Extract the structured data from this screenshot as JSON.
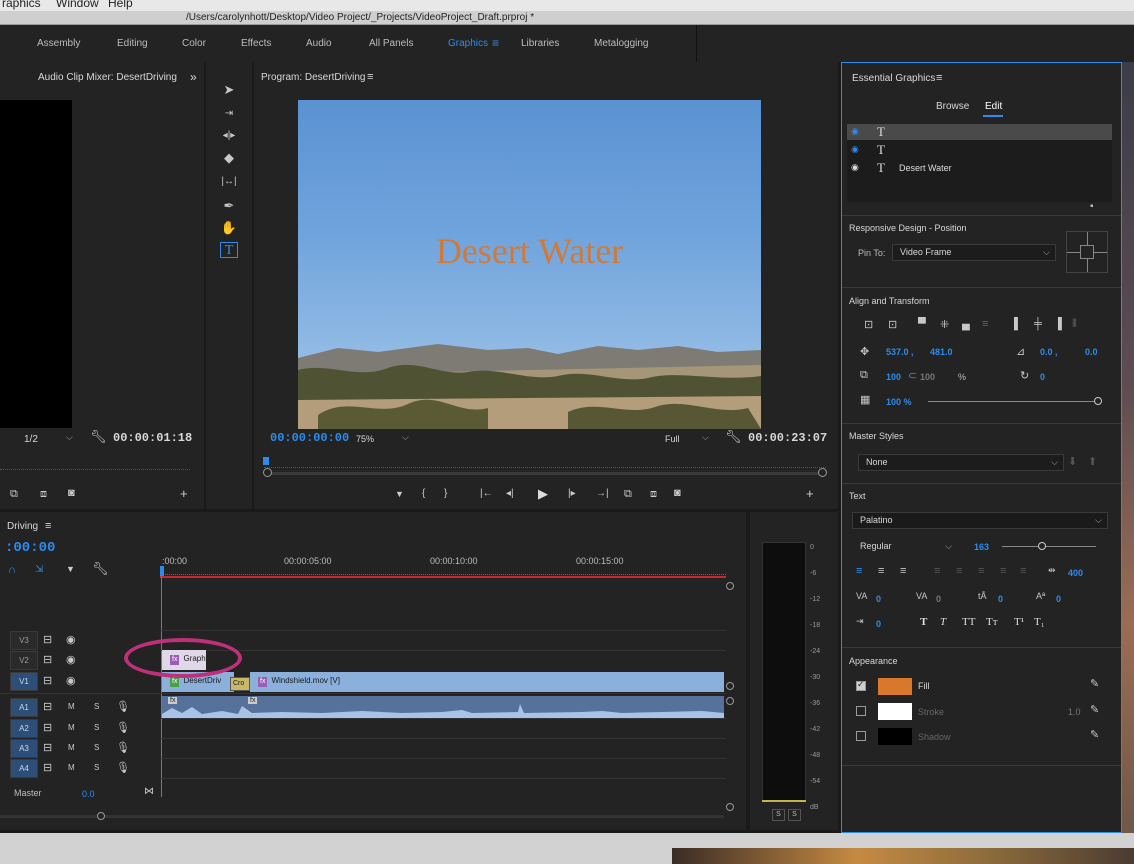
{
  "menubar": {
    "items": [
      "raphics",
      "Window",
      "Help"
    ]
  },
  "window": {
    "title": "/Users/carolynhott/Desktop/Video Project/_Projects/VideoProject_Draft.prproj *"
  },
  "workspaces": {
    "tabs": [
      "Assembly",
      "Editing",
      "Color",
      "Effects",
      "Audio",
      "All Panels",
      "Graphics",
      "Libraries",
      "Metalogging"
    ],
    "active": "Graphics",
    "menu_glyph": "≡"
  },
  "mixer": {
    "title": "Audio Clip Mixer: DesertDriving",
    "more": "»",
    "fraction": "1/2",
    "timecode": "00:00:01:18"
  },
  "program": {
    "title": "Program: DesertDriving",
    "menu_glyph": "≡",
    "video_title": "Desert Water",
    "timecode_current": "00:00:00:00",
    "zoom": "75%",
    "resolution": "Full",
    "timecode_duration": "00:00:23:07"
  },
  "timeline": {
    "title": "Driving",
    "menu_glyph": "≡",
    "timecode": ":00:00",
    "ruler": [
      ":00:00",
      "00:00:05:00",
      "00:00:10:00",
      "00:00:15:00"
    ],
    "tracks": [
      {
        "label": "V3",
        "on": false
      },
      {
        "label": "V2",
        "on": false
      },
      {
        "label": "V1",
        "on": true
      },
      {
        "label": "A1",
        "on": true
      },
      {
        "label": "A2",
        "on": true
      },
      {
        "label": "A3",
        "on": true
      },
      {
        "label": "A4",
        "on": true
      }
    ],
    "track_m": "M",
    "track_s": "S",
    "master_label": "Master",
    "master_value": "0.0",
    "clips": {
      "graphic": "Graph",
      "desert": "DesertDriv",
      "windshield": "Windshield.mov [V]",
      "cross": "Cro"
    }
  },
  "meter": {
    "scale": [
      "0",
      "-6",
      "-12",
      "-18",
      "-24",
      "-30",
      "-36",
      "-42",
      "-48",
      "-54",
      "dB"
    ],
    "solo": [
      "S",
      "S"
    ]
  },
  "essential_graphics": {
    "title": "Essential Graphics",
    "menu_glyph": "≡",
    "tabs": [
      "Browse",
      "Edit"
    ],
    "active_tab": "Edit",
    "layers": [
      {
        "glyph": "T",
        "name": ""
      },
      {
        "glyph": "T",
        "name": ""
      },
      {
        "glyph": "T",
        "name": "Desert Water"
      }
    ],
    "responsive_title": "Responsive Design - Position",
    "pin_label": "Pin To:",
    "pin_value": "Video Frame",
    "align_title": "Align and Transform",
    "pos_x": "537.0 ,",
    "pos_y": "481.0",
    "anchor_x": "0.0 ,",
    "anchor_y": "0.0",
    "scale": "100",
    "scale_h": "100",
    "scale_unit": "%",
    "rotation": "0",
    "opacity": "100 %",
    "master_styles_title": "Master Styles",
    "master_style": "None",
    "text_title": "Text",
    "font": "Palatino",
    "font_style": "Regular",
    "font_size": "163",
    "tracking": "400",
    "kerning": "0",
    "leading": "0",
    "baseline": "0",
    "tsume": "0",
    "tab_width": "0",
    "caps_buttons": [
      "T",
      "T",
      "TT",
      "Tт",
      "T¹",
      "T₁"
    ],
    "appearance_title": "Appearance",
    "fill_label": "Fill",
    "stroke_label": "Stroke",
    "stroke_value": "1.0",
    "shadow_label": "Shadow",
    "fill_color": "#d9782a",
    "stroke_color": "#ffffff",
    "shadow_color": "#000000",
    "fill_checked": true
  },
  "accent_color": "#2d8ceb",
  "annotation_color": "#c0307a"
}
